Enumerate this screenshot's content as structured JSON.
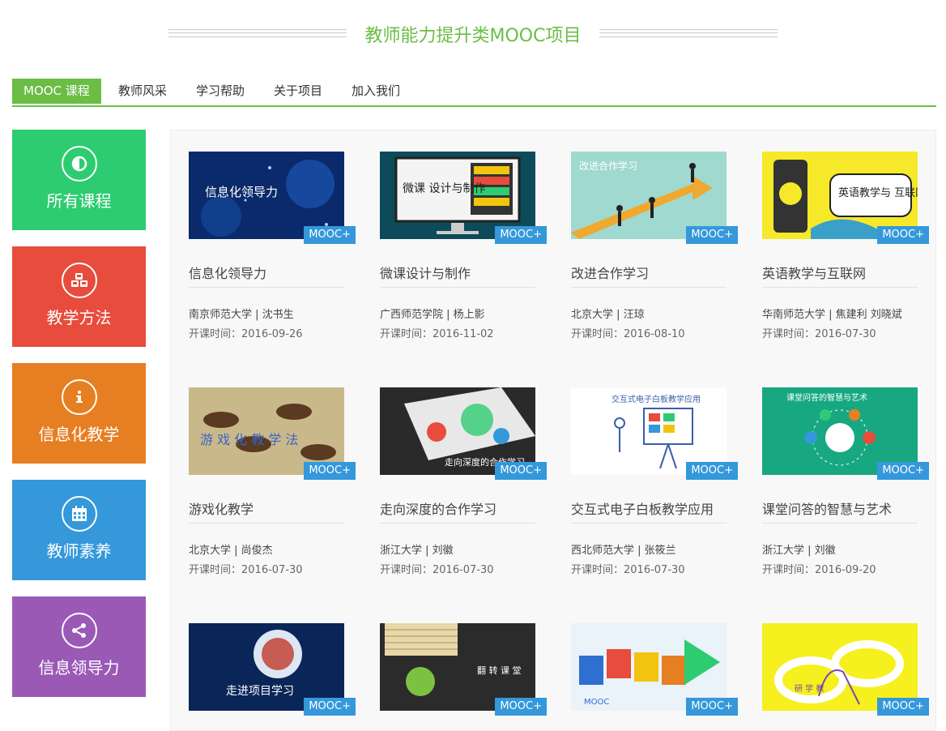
{
  "header": {
    "title": "教师能力提升类MOOC项目"
  },
  "tabs": [
    {
      "label": "MOOC 课程"
    },
    {
      "label": "教师风采"
    },
    {
      "label": "学习帮助"
    },
    {
      "label": "关于项目"
    },
    {
      "label": "加入我们"
    }
  ],
  "sidebar": [
    {
      "label": "所有课程",
      "icon": "half-circle-icon",
      "color": "#2ecc71"
    },
    {
      "label": "教学方法",
      "icon": "cubes-icon",
      "color": "#e74c3c"
    },
    {
      "label": "信息化教学",
      "icon": "info-icon",
      "color": "#e67e22"
    },
    {
      "label": "教师素养",
      "icon": "calendar-icon",
      "color": "#3498db"
    },
    {
      "label": "信息领导力",
      "icon": "share-icon",
      "color": "#9b59b6"
    }
  ],
  "badge": "MOOC+",
  "date_prefix": "开课时间：",
  "courses": [
    {
      "title": "信息化领导力",
      "school": "南京师范大学",
      "teacher": "沈书生",
      "date": "2016-09-26",
      "thumb_text": "信息化领导力"
    },
    {
      "title": "微课设计与制作",
      "school": "广西师范学院",
      "teacher": "杨上影",
      "date": "2016-11-02",
      "thumb_text": "微课 设计与制作"
    },
    {
      "title": "改进合作学习",
      "school": "北京大学",
      "teacher": "汪琼",
      "date": "2016-08-10",
      "thumb_text": "改进合作学习"
    },
    {
      "title": "英语教学与互联网",
      "school": "华南师范大学",
      "teacher": "焦建利 刘晓斌",
      "date": "2016-07-30",
      "thumb_text": "英语教学与 互联网"
    },
    {
      "title": "游戏化教学",
      "school": "北京大学",
      "teacher": "尚俊杰",
      "date": "2016-07-30",
      "thumb_text": "游 戏 化 教 学 法"
    },
    {
      "title": "走向深度的合作学习",
      "school": "浙江大学",
      "teacher": "刘徽",
      "date": "2016-07-30",
      "thumb_text": "走向深度的合作学习"
    },
    {
      "title": "交互式电子白板教学应用",
      "school": "西北师范大学",
      "teacher": "张筱兰",
      "date": "2016-07-30",
      "thumb_text": "交互式电子白板教学应用"
    },
    {
      "title": "课堂问答的智慧与艺术",
      "school": "浙江大学",
      "teacher": "刘徽",
      "date": "2016-09-20",
      "thumb_text": "课堂问答的智慧与艺术"
    },
    {
      "title": "",
      "school": "",
      "teacher": "",
      "date": "",
      "thumb_text": "走进项目学习"
    },
    {
      "title": "",
      "school": "",
      "teacher": "",
      "date": "",
      "thumb_text": "翻 转 课 堂"
    },
    {
      "title": "",
      "school": "",
      "teacher": "",
      "date": "",
      "thumb_text": "MOOC"
    },
    {
      "title": "",
      "school": "",
      "teacher": "",
      "date": "",
      "thumb_text": "研 学 教"
    }
  ]
}
